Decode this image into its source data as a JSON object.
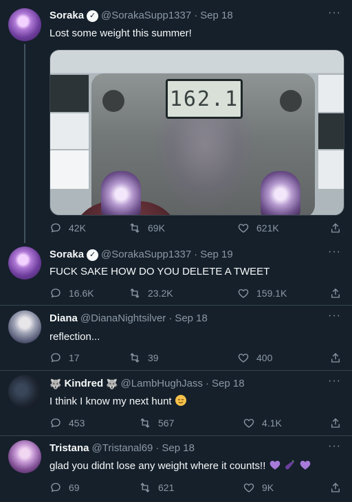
{
  "tweets": [
    {
      "name": "Soraka",
      "handle": "@SorakaSupp1337",
      "time": "Sep 18",
      "verified": true,
      "text": "Lost some weight this summer!",
      "media": {
        "scale_reading": "162.1"
      },
      "actions": {
        "replies": "42K",
        "retweets": "69K",
        "likes": "621K"
      }
    },
    {
      "name": "Soraka",
      "handle": "@SorakaSupp1337",
      "time": "Sep 19",
      "verified": true,
      "text": "FUCK SAKE HOW DO YOU DELETE A TWEET",
      "actions": {
        "replies": "16.6K",
        "retweets": "23.2K",
        "likes": "159.1K"
      }
    },
    {
      "name": "Diana",
      "handle": "@DianaNightsilver",
      "time": "Sep 18",
      "text": "reflection...",
      "actions": {
        "replies": "17",
        "retweets": "39",
        "likes": "400"
      }
    },
    {
      "name": "Kindred",
      "handle": "@LambHughJass",
      "time": "Sep 18",
      "name_icons": [
        "wolf-emoji-icon",
        "wolf-emoji-icon"
      ],
      "text": "I think I know my next hunt",
      "text_emoji": "relieved-face-emoji",
      "actions": {
        "replies": "453",
        "retweets": "567",
        "likes": "4.1K"
      }
    },
    {
      "name": "Tristana",
      "handle": "@Tristanal69",
      "time": "Sep 18",
      "text": "glad you didnt lose any weight where it counts!!",
      "text_emojis": [
        "purple-heart-emoji",
        "eggplant-emoji",
        "purple-heart-emoji"
      ],
      "actions": {
        "replies": "69",
        "retweets": "621",
        "likes": "9K"
      }
    }
  ],
  "ui": {
    "more_label": "···",
    "separator": "·",
    "verified_glyph": "✓",
    "wolf_glyph": "🐺",
    "colors": {
      "background": "#15202b",
      "text": "#f7f9f9",
      "muted": "#8b98a5",
      "thread_line": "#42535f"
    }
  }
}
